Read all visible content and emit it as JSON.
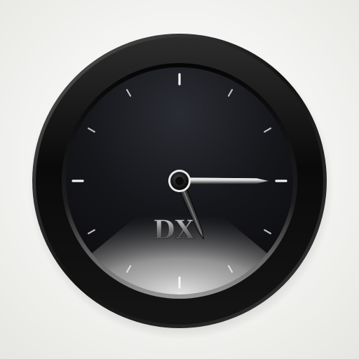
{
  "clock": {
    "brand": "DX",
    "time": {
      "hour": 5,
      "minute": 15,
      "second": 0
    },
    "tick_count": 12,
    "colors": {
      "bezel": "#0b0b0b",
      "dial_dark": "#141519",
      "dial_light": "#d8d8d8",
      "hand": "#2a2a2a",
      "hand_highlight": "#f2f2f2",
      "tick": "#f4f4f4"
    }
  }
}
